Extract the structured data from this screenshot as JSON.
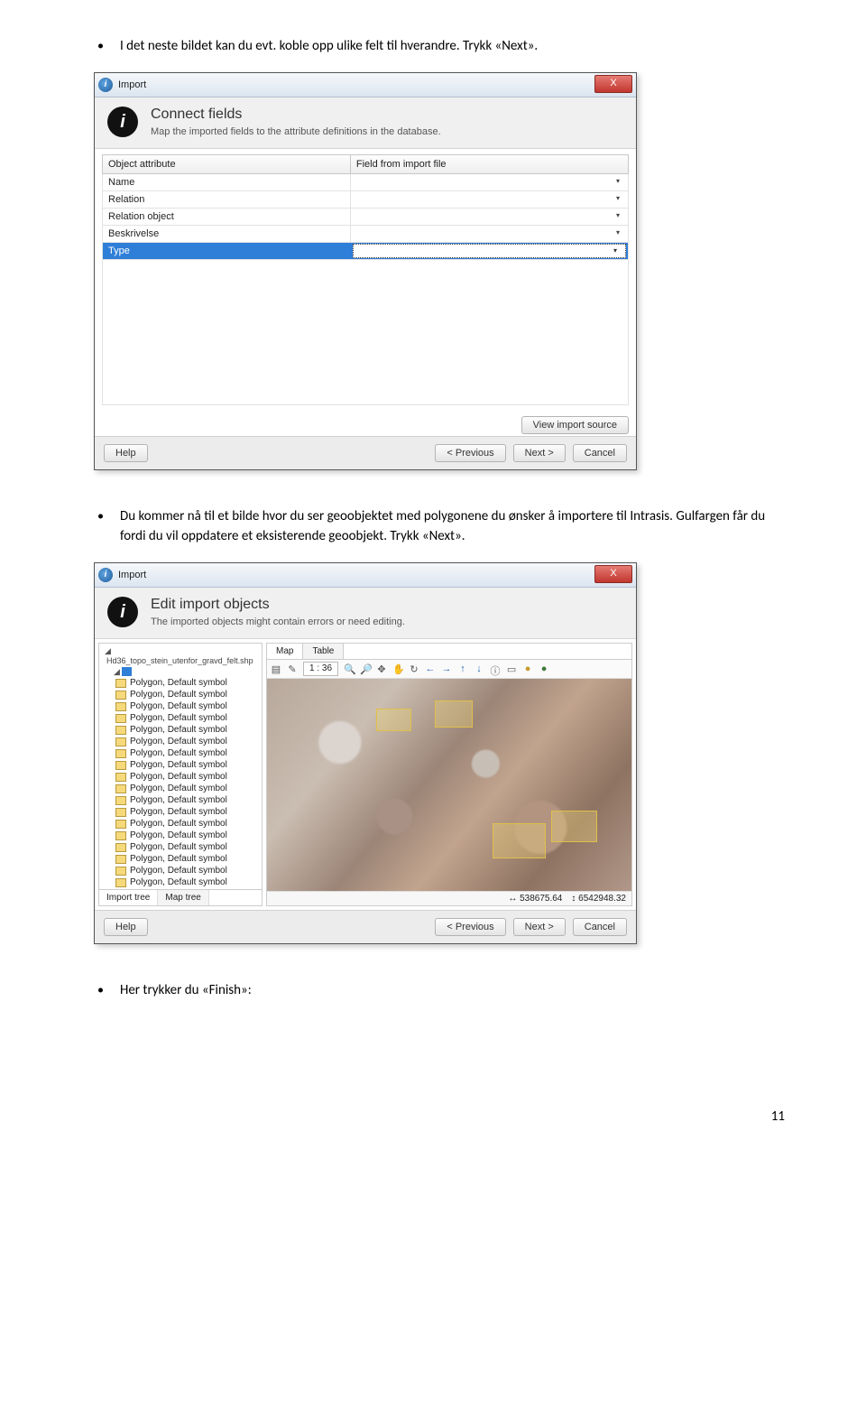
{
  "bullets": {
    "b1": "I det neste bildet kan du evt. koble opp ulike felt til hverandre. Trykk «Next».",
    "b2": "Du kommer nå til et bilde hvor du ser geoobjektet med polygonene du ønsker å importere til Intrasis. Gulfargen får du fordi du vil oppdatere et eksisterende geoobjekt. Trykk «Next».",
    "b3": "Her trykker du «Finish»:"
  },
  "dlg1": {
    "title": "Import",
    "close": "X",
    "header_title": "Connect fields",
    "header_sub": "Map the imported fields to the attribute definitions in the database.",
    "col_attr": "Object attribute",
    "col_field": "Field from import file",
    "rows": {
      "r0": "Name",
      "r1": "Relation",
      "r2": "Relation object",
      "r3": "Beskrivelse",
      "r4": "Type"
    },
    "view_source": "View import source",
    "help": "Help",
    "prev": "< Previous",
    "next": "Next >",
    "cancel": "Cancel"
  },
  "dlg2": {
    "title": "Import",
    "close": "X",
    "header_title": "Edit import objects",
    "header_sub": "The imported objects might contain errors or need editing.",
    "tree_root": "Hd36_topo_stein_utenfor_gravd_felt.shp",
    "tree_item_label": "Polygon, Default symbol",
    "tree_tab_import": "Import tree",
    "tree_tab_map": "Map tree",
    "map_tab_map": "Map",
    "map_tab_table": "Table",
    "scale": "1 : 36",
    "coord_x": "↔ 538675.64",
    "coord_y": "↕ 6542948.32",
    "help": "Help",
    "prev": "< Previous",
    "next": "Next >",
    "cancel": "Cancel"
  },
  "page_number": "11"
}
